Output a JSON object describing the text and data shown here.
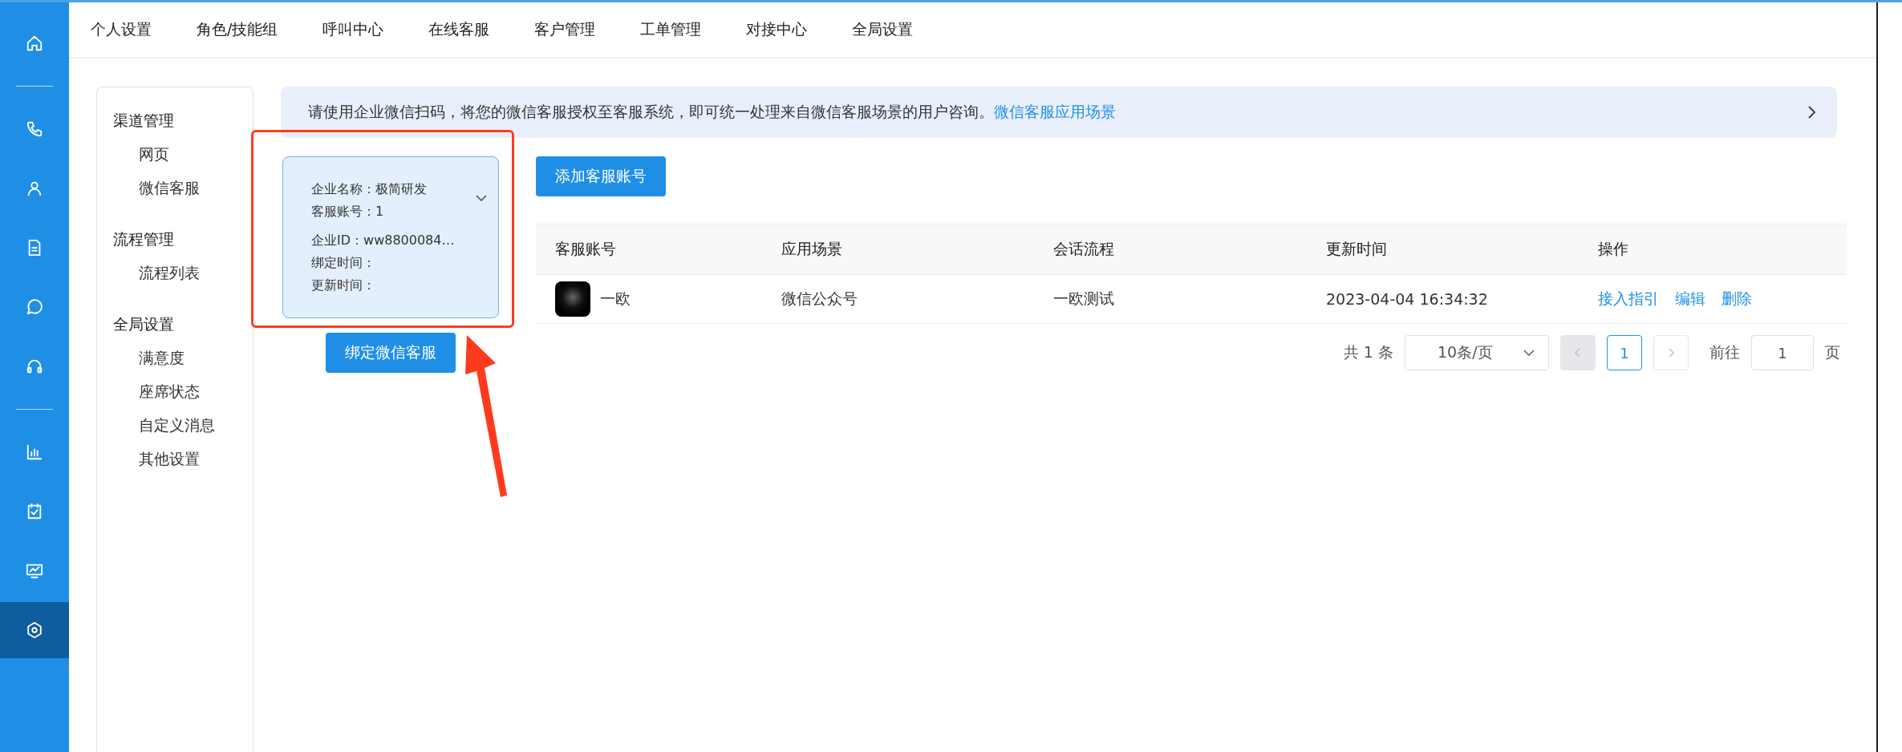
{
  "nav_rail": [
    {
      "kind": "home",
      "selected": false
    },
    {
      "kind": "divider"
    },
    {
      "kind": "phone",
      "selected": false
    },
    {
      "kind": "user",
      "selected": false
    },
    {
      "kind": "document",
      "selected": false
    },
    {
      "kind": "chat",
      "selected": false
    },
    {
      "kind": "headset",
      "selected": false
    },
    {
      "kind": "divider"
    },
    {
      "kind": "chart",
      "selected": false
    },
    {
      "kind": "checklist",
      "selected": false
    },
    {
      "kind": "monitor",
      "selected": false
    },
    {
      "kind": "settings",
      "selected": true
    }
  ],
  "top_tabs": [
    {
      "label": "个人设置"
    },
    {
      "label": "角色/技能组"
    },
    {
      "label": "呼叫中心"
    },
    {
      "label": "在线客服"
    },
    {
      "label": "客户管理"
    },
    {
      "label": "工单管理"
    },
    {
      "label": "对接中心"
    },
    {
      "label": "全局设置"
    }
  ],
  "sidebar": {
    "groups": [
      {
        "title": "渠道管理",
        "items": [
          "网页",
          "微信客服"
        ]
      },
      {
        "title": "流程管理",
        "items": [
          "流程列表"
        ]
      },
      {
        "title": "全局设置",
        "items": [
          "满意度",
          "座席状态",
          "自定义消息",
          "其他设置"
        ]
      }
    ]
  },
  "banner": {
    "text": "请使用企业微信扫码，将您的微信客服授权至客服系统，即可统一处理来自微信客服场景的用户咨询。",
    "link": "微信客服应用场景"
  },
  "enterprise_card": {
    "lines_top": [
      "企业名称：极简研发",
      "客服账号：1"
    ],
    "lines_bottom": [
      "企业ID：ww8800084…",
      "绑定时间：",
      "更新时间："
    ]
  },
  "bind_button": "绑定微信客服",
  "add_button": "添加客服账号",
  "table": {
    "columns": [
      "客服账号",
      "应用场景",
      "会话流程",
      "更新时间",
      "操作"
    ],
    "rows": [
      {
        "account": "一欧",
        "scene": "微信公众号",
        "flow": "一欧测试",
        "updated": "2023-04-04 16:34:32",
        "actions": [
          "接入指引",
          "编辑",
          "删除"
        ]
      }
    ]
  },
  "pagination": {
    "total": "共 1 条",
    "page_size": "10条/页",
    "pages": [
      {
        "label": "1",
        "selected": true
      }
    ],
    "goto_label": "前往",
    "goto_value": "1",
    "page_unit": "页"
  },
  "annotation": {
    "color": "#ff3b1f"
  }
}
